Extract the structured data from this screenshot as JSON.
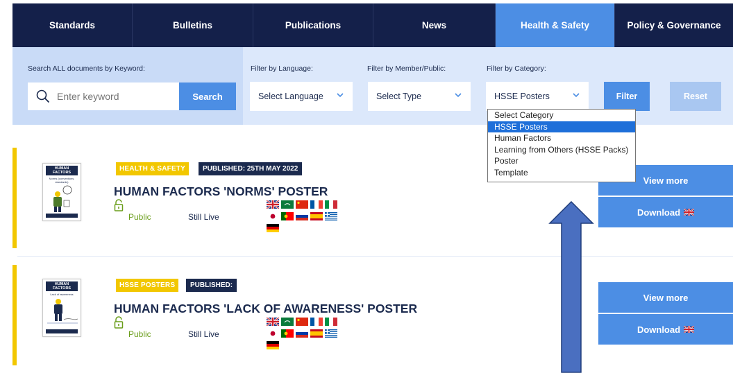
{
  "nav": {
    "tabs": [
      {
        "label": "Standards"
      },
      {
        "label": "Bulletins"
      },
      {
        "label": "Publications"
      },
      {
        "label": "News"
      },
      {
        "label": "Health & Safety",
        "active": true
      },
      {
        "label": "Policy & Governance"
      }
    ]
  },
  "filters": {
    "keyword_label": "Search ALL documents by Keyword:",
    "keyword_placeholder": "Enter keyword",
    "search_label": "Search",
    "language_label": "Filter by Language:",
    "language_value": "Select Language",
    "member_label": "Filter by Member/Public:",
    "member_value": "Select Type",
    "category_label": "Filter by Category:",
    "category_value": "HSSE Posters",
    "filter_button": "Filter",
    "reset_button": "Reset"
  },
  "category_dropdown": {
    "options": [
      "Select Category",
      "HSSE Posters",
      "Human Factors",
      "Learning from Others (HSSE Packs)",
      "Poster",
      "Template"
    ],
    "selected": "HSSE Posters"
  },
  "documents": [
    {
      "thumb_title": "HUMAN FACTORS",
      "thumb_subtitle": "Norms (conventions, standards)",
      "category_badge": "Health & Safety",
      "published_badge": "PUBLISHED: 25TH MAY 2022",
      "title": "HUMAN FACTORS 'NORMS' POSTER",
      "access": "Public",
      "status": "Still Live",
      "view_label": "View more",
      "download_label": "Download"
    },
    {
      "thumb_title": "HUMAN FACTORS",
      "thumb_subtitle": "Lack of awareness",
      "category_badge": "HSSE Posters",
      "published_badge": "PUBLISHED:",
      "title": "HUMAN FACTORS 'LACK OF AWARENESS' POSTER",
      "access": "Public",
      "status": "Still Live",
      "view_label": "View more",
      "download_label": "Download"
    }
  ],
  "flag_languages": [
    "english-flag",
    "saudi-flag",
    "chinese-flag",
    "french-flag",
    "italian-flag",
    "japanese-flag",
    "portuguese-flag",
    "russian-flag",
    "spanish-flag",
    "greek-flag",
    "german-flag"
  ],
  "colors": {
    "navy": "#14204a",
    "accent_blue": "#4c8ee4",
    "yellow": "#f2c700",
    "public_green": "#6a9d1a"
  }
}
